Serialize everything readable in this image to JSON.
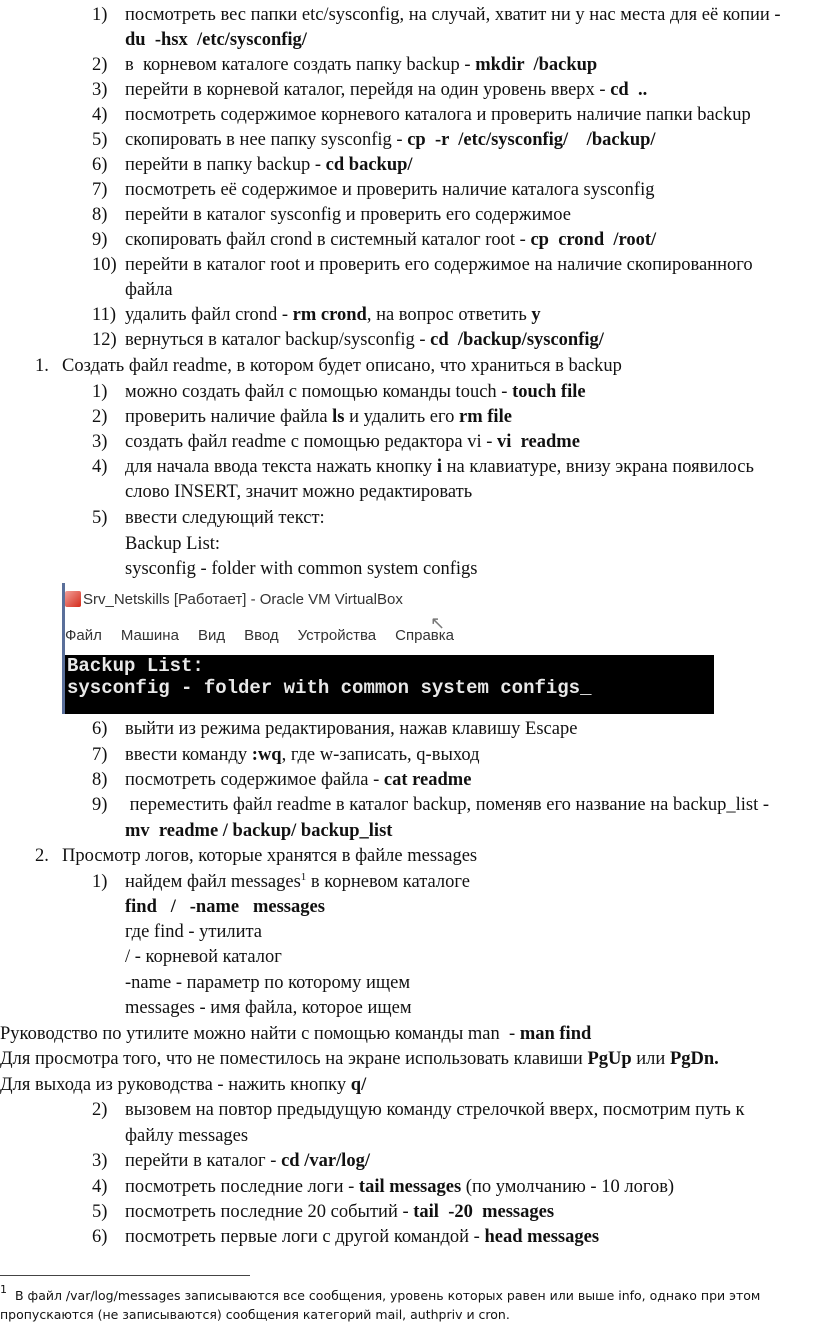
{
  "lines": [
    {
      "num": "1)",
      "lvl": 2,
      "parts": [
        [
          "посмотреть вес папки etc/sysconfig, на случай, хватит ни у нас места для её копии -",
          0
        ]
      ]
    },
    {
      "num": "",
      "lvl": 2,
      "parts": [
        [
          "du  -hsx  /etc/sysconfig/",
          1
        ]
      ]
    },
    {
      "num": "2)",
      "lvl": 2,
      "parts": [
        [
          "в  корневом каталоге создать папку backup - ",
          0
        ],
        [
          "mkdir  /backup",
          1
        ]
      ]
    },
    {
      "num": "3)",
      "lvl": 2,
      "parts": [
        [
          "перейти в корневой каталог, перейдя на один уровень вверх - ",
          0
        ],
        [
          "cd  ..",
          1
        ]
      ]
    },
    {
      "num": "4)",
      "lvl": 2,
      "parts": [
        [
          "посмотреть содержимое корневого каталога и проверить наличие папки backup",
          0
        ]
      ]
    },
    {
      "num": "5)",
      "lvl": 2,
      "parts": [
        [
          "скопировать в нее папку sysconfig - ",
          0
        ],
        [
          "cp  -r  /etc/sysconfig/    /backup/",
          1
        ]
      ]
    },
    {
      "num": "6)",
      "lvl": 2,
      "parts": [
        [
          "перейти в папку backup - ",
          0
        ],
        [
          "cd backup/",
          1
        ]
      ]
    },
    {
      "num": "7)",
      "lvl": 2,
      "parts": [
        [
          "посмотреть её содержимое и проверить наличие каталога sysconfig",
          0
        ]
      ]
    },
    {
      "num": "8)",
      "lvl": 2,
      "parts": [
        [
          "перейти в каталог sysconfig и проверить его содержимое",
          0
        ]
      ]
    },
    {
      "num": "9)",
      "lvl": 2,
      "parts": [
        [
          "скопировать файл crond в системный каталог root - ",
          0
        ],
        [
          "cp  crond  /root/",
          1
        ]
      ]
    },
    {
      "num": "10)",
      "lvl": 2,
      "parts": [
        [
          "перейти в каталог root и проверить его содержимое на наличие скопированного",
          0
        ]
      ]
    },
    {
      "num": "",
      "lvl": 2,
      "parts": [
        [
          "файла",
          0
        ]
      ]
    },
    {
      "num": "11)",
      "lvl": 2,
      "parts": [
        [
          "удалить файл crond - ",
          0
        ],
        [
          "rm crond",
          1
        ],
        [
          ", на вопрос ответить ",
          0
        ],
        [
          "y",
          1
        ]
      ]
    },
    {
      "num": "12)",
      "lvl": 2,
      "parts": [
        [
          "вернуться в каталог backup/sysconfig - ",
          0
        ],
        [
          "cd  /backup/sysconfig/",
          1
        ]
      ]
    },
    {
      "num": "1.",
      "lvl": 1,
      "parts": [
        [
          "Создать файл readme, в котором будет описано, что храниться в backup",
          0
        ]
      ]
    },
    {
      "num": "1)",
      "lvl": 2,
      "parts": [
        [
          "можно создать файл с помощью команды touch - ",
          0
        ],
        [
          "touch file",
          1
        ]
      ]
    },
    {
      "num": "2)",
      "lvl": 2,
      "parts": [
        [
          "проверить наличие файла ",
          0
        ],
        [
          "ls",
          1
        ],
        [
          " и удалить его ",
          0
        ],
        [
          "rm file",
          1
        ]
      ]
    },
    {
      "num": "3)",
      "lvl": 2,
      "parts": [
        [
          "создать файл readme с помощью редактора vi - ",
          0
        ],
        [
          "vi  readme",
          1
        ]
      ]
    },
    {
      "num": "4)",
      "lvl": 2,
      "parts": [
        [
          "для начала ввода текста нажать кнопку ",
          0
        ],
        [
          "i",
          1
        ],
        [
          " на клавиатуре, внизу экрана появилось",
          0
        ]
      ]
    },
    {
      "num": "",
      "lvl": 2,
      "parts": [
        [
          "слово INSERT, значит можно редактировать",
          0
        ]
      ]
    },
    {
      "num": "5)",
      "lvl": 2,
      "parts": [
        [
          "ввести следующий текст:",
          0
        ]
      ]
    },
    {
      "num": "",
      "lvl": 2,
      "parts": [
        [
          "Backup List:",
          0
        ]
      ]
    },
    {
      "num": "",
      "lvl": 2,
      "parts": [
        [
          "sysconfig - folder with common system configs",
          0
        ]
      ]
    },
    {
      "num": "6)",
      "lvl": 2,
      "parts": [
        [
          "выйти из режима редактирования, нажав клавишу Escape",
          0
        ]
      ]
    },
    {
      "num": "7)",
      "lvl": 2,
      "parts": [
        [
          "ввести команду ",
          0
        ],
        [
          ":wq",
          1
        ],
        [
          ", где w-записать, q-выход",
          0
        ]
      ]
    },
    {
      "num": "8)",
      "lvl": 2,
      "parts": [
        [
          "посмотреть содержимое файла - ",
          0
        ],
        [
          "cat readme",
          1
        ]
      ]
    },
    {
      "num": "9)",
      "lvl": 2,
      "parts": [
        [
          " переместить файл readme в каталог backup, поменяв его название на backup_list -",
          0
        ]
      ]
    },
    {
      "num": "",
      "lvl": 2,
      "parts": [
        [
          "mv  readme / backup/ backup_list",
          1
        ]
      ]
    },
    {
      "num": "2.",
      "lvl": 1,
      "parts": [
        [
          "Просмотр логов, которые хранятся в файле messages",
          0
        ]
      ]
    },
    {
      "num": "1)",
      "lvl": 2,
      "parts": [
        [
          "найдем файл messages",
          0
        ],
        [
          "1",
          2
        ],
        [
          " в корневом каталоге",
          0
        ]
      ]
    },
    {
      "num": "",
      "lvl": 2,
      "parts": [
        [
          "find   /   -name   messages",
          1
        ]
      ]
    },
    {
      "num": "",
      "lvl": 2,
      "parts": [
        [
          "где find - утилита",
          0
        ]
      ]
    },
    {
      "num": "",
      "lvl": 2,
      "parts": [
        [
          "/ - корневой каталог",
          0
        ]
      ]
    },
    {
      "num": "",
      "lvl": 2,
      "parts": [
        [
          "-name - параметр по которому ищем",
          0
        ]
      ]
    },
    {
      "num": "",
      "lvl": 2,
      "parts": [
        [
          "messages - имя файла, которое ищем",
          0
        ]
      ]
    },
    {
      "num": "",
      "lvl": 0,
      "parts": [
        [
          "Руководство по утилите можно найти с помощью команды man  - ",
          0
        ],
        [
          "man find",
          1
        ]
      ]
    },
    {
      "num": "",
      "lvl": 0,
      "parts": [
        [
          "Для просмотра того, что не поместилось на экране использовать клавиши ",
          0
        ],
        [
          "PgUp",
          1
        ],
        [
          " или ",
          0
        ],
        [
          "PgDn.",
          1
        ]
      ]
    },
    {
      "num": "",
      "lvl": 0,
      "parts": [
        [
          "Для выхода из руководства - нажить кнопку ",
          0
        ],
        [
          "q/",
          1
        ]
      ]
    },
    {
      "num": "2)",
      "lvl": 2,
      "parts": [
        [
          "вызовем на повтор предыдущую команду стрелочкой вверх, посмотрим путь к",
          0
        ]
      ]
    },
    {
      "num": "",
      "lvl": 2,
      "parts": [
        [
          "файлу messages",
          0
        ]
      ]
    },
    {
      "num": "3)",
      "lvl": 2,
      "parts": [
        [
          "перейти в каталог - ",
          0
        ],
        [
          "cd /var/log/",
          1
        ]
      ]
    },
    {
      "num": "4)",
      "lvl": 2,
      "parts": [
        [
          "посмотреть последние логи - ",
          0
        ],
        [
          "tail messages",
          1
        ],
        [
          " (по умолчанию - 10 логов)",
          0
        ]
      ]
    },
    {
      "num": "5)",
      "lvl": 2,
      "parts": [
        [
          "посмотреть последние 20 событий - ",
          0
        ],
        [
          "tail  -20  messages",
          1
        ]
      ]
    },
    {
      "num": "6)",
      "lvl": 2,
      "parts": [
        [
          "посмотреть первые логи с другой командой - ",
          0
        ],
        [
          "head messages",
          1
        ]
      ]
    }
  ],
  "screenshot": {
    "window_title": "Srv_Netskills [Работает] - Oracle VM VirtualBox",
    "menu": [
      "Файл",
      "Машина",
      "Вид",
      "Ввод",
      "Устройства",
      "Справка"
    ],
    "terminal_lines": [
      "Backup List:",
      "sysconfig - folder with common system configs_"
    ],
    "app_icon": "virtualbox-icon",
    "cursor_icon": "mouse-pointer-icon"
  },
  "footnote": {
    "mark": "1",
    "lines": [
      "В файл /var/log/messages записываются все сообщения, уровень которых равен или выше info, однако при этом",
      "пропускаются (не записываются) сообщения категорий mail, authpriv и cron."
    ]
  }
}
